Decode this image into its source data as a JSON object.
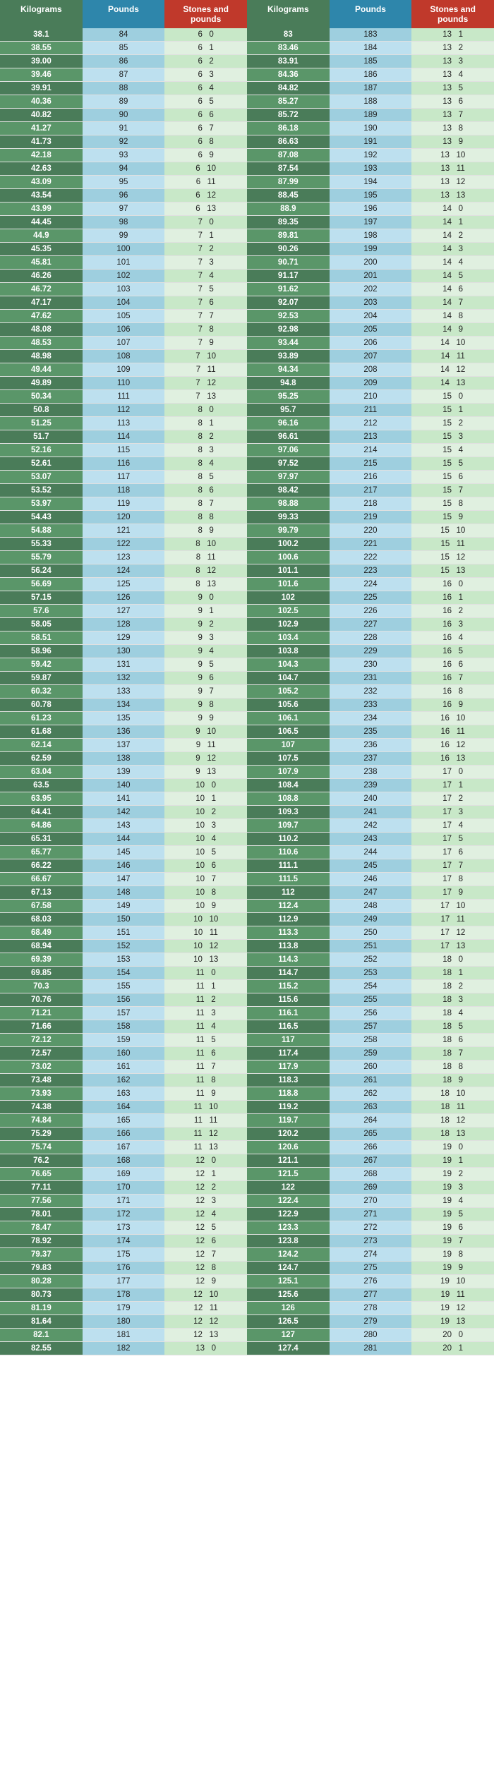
{
  "headers": {
    "kg": "Kilograms",
    "lb": "Pounds",
    "st": "Stones and pounds",
    "kg2": "Kilograms",
    "lb2": "Pounds",
    "st2": "Stones and pounds"
  },
  "rows": [
    [
      38.1,
      84,
      6,
      0,
      83.0,
      183,
      13,
      1
    ],
    [
      38.55,
      85,
      6,
      1,
      83.46,
      184,
      13,
      2
    ],
    [
      39.0,
      86,
      6,
      2,
      83.91,
      185,
      13,
      3
    ],
    [
      39.46,
      87,
      6,
      3,
      84.36,
      186,
      13,
      4
    ],
    [
      39.91,
      88,
      6,
      4,
      84.82,
      187,
      13,
      5
    ],
    [
      40.36,
      89,
      6,
      5,
      85.27,
      188,
      13,
      6
    ],
    [
      40.82,
      90,
      6,
      6,
      85.72,
      189,
      13,
      7
    ],
    [
      41.27,
      91,
      6,
      7,
      86.18,
      190,
      13,
      8
    ],
    [
      41.73,
      92,
      6,
      8,
      86.63,
      191,
      13,
      9
    ],
    [
      42.18,
      93,
      6,
      9,
      87.08,
      192,
      13,
      10
    ],
    [
      42.63,
      94,
      6,
      10,
      87.54,
      193,
      13,
      11
    ],
    [
      43.09,
      95,
      6,
      11,
      87.99,
      194,
      13,
      12
    ],
    [
      43.54,
      96,
      6,
      12,
      88.45,
      195,
      13,
      13
    ],
    [
      43.99,
      97,
      6,
      13,
      88.9,
      196,
      14,
      0
    ],
    [
      44.45,
      98,
      7,
      0,
      89.35,
      197,
      14,
      1
    ],
    [
      44.9,
      99,
      7,
      1,
      89.81,
      198,
      14,
      2
    ],
    [
      45.35,
      100,
      7,
      2,
      90.26,
      199,
      14,
      3
    ],
    [
      45.81,
      101,
      7,
      3,
      90.71,
      200,
      14,
      4
    ],
    [
      46.26,
      102,
      7,
      4,
      91.17,
      201,
      14,
      5
    ],
    [
      46.72,
      103,
      7,
      5,
      91.62,
      202,
      14,
      6
    ],
    [
      47.17,
      104,
      7,
      6,
      92.07,
      203,
      14,
      7
    ],
    [
      47.62,
      105,
      7,
      7,
      92.53,
      204,
      14,
      8
    ],
    [
      48.08,
      106,
      7,
      8,
      92.98,
      205,
      14,
      9
    ],
    [
      48.53,
      107,
      7,
      9,
      93.44,
      206,
      14,
      10
    ],
    [
      48.98,
      108,
      7,
      10,
      93.89,
      207,
      14,
      11
    ],
    [
      49.44,
      109,
      7,
      11,
      94.34,
      208,
      14,
      12
    ],
    [
      49.89,
      110,
      7,
      12,
      94.8,
      209,
      14,
      13
    ],
    [
      50.34,
      111,
      7,
      13,
      95.25,
      210,
      15,
      0
    ],
    [
      50.8,
      112,
      8,
      0,
      95.7,
      211,
      15,
      1
    ],
    [
      51.25,
      113,
      8,
      1,
      96.16,
      212,
      15,
      2
    ],
    [
      51.7,
      114,
      8,
      2,
      96.61,
      213,
      15,
      3
    ],
    [
      52.16,
      115,
      8,
      3,
      97.06,
      214,
      15,
      4
    ],
    [
      52.61,
      116,
      8,
      4,
      97.52,
      215,
      15,
      5
    ],
    [
      53.07,
      117,
      8,
      5,
      97.97,
      216,
      15,
      6
    ],
    [
      53.52,
      118,
      8,
      6,
      98.42,
      217,
      15,
      7
    ],
    [
      53.97,
      119,
      8,
      7,
      98.88,
      218,
      15,
      8
    ],
    [
      54.43,
      120,
      8,
      8,
      99.33,
      219,
      15,
      9
    ],
    [
      54.88,
      121,
      8,
      9,
      99.79,
      220,
      15,
      10
    ],
    [
      55.33,
      122,
      8,
      10,
      100.2,
      221,
      15,
      11
    ],
    [
      55.79,
      123,
      8,
      11,
      100.6,
      222,
      15,
      12
    ],
    [
      56.24,
      124,
      8,
      12,
      101.1,
      223,
      15,
      13
    ],
    [
      56.69,
      125,
      8,
      13,
      101.6,
      224,
      16,
      0
    ],
    [
      57.15,
      126,
      9,
      0,
      102.0,
      225,
      16,
      1
    ],
    [
      57.6,
      127,
      9,
      1,
      102.5,
      226,
      16,
      2
    ],
    [
      58.05,
      128,
      9,
      2,
      102.9,
      227,
      16,
      3
    ],
    [
      58.51,
      129,
      9,
      3,
      103.4,
      228,
      16,
      4
    ],
    [
      58.96,
      130,
      9,
      4,
      103.8,
      229,
      16,
      5
    ],
    [
      59.42,
      131,
      9,
      5,
      104.3,
      230,
      16,
      6
    ],
    [
      59.87,
      132,
      9,
      6,
      104.7,
      231,
      16,
      7
    ],
    [
      60.32,
      133,
      9,
      7,
      105.2,
      232,
      16,
      8
    ],
    [
      60.78,
      134,
      9,
      8,
      105.6,
      233,
      16,
      9
    ],
    [
      61.23,
      135,
      9,
      9,
      106.1,
      234,
      16,
      10
    ],
    [
      61.68,
      136,
      9,
      10,
      106.5,
      235,
      16,
      11
    ],
    [
      62.14,
      137,
      9,
      11,
      107.0,
      236,
      16,
      12
    ],
    [
      62.59,
      138,
      9,
      12,
      107.5,
      237,
      16,
      13
    ],
    [
      63.04,
      139,
      9,
      13,
      107.9,
      238,
      17,
      0
    ],
    [
      63.5,
      140,
      10,
      0,
      108.4,
      239,
      17,
      1
    ],
    [
      63.95,
      141,
      10,
      1,
      108.8,
      240,
      17,
      2
    ],
    [
      64.41,
      142,
      10,
      2,
      109.3,
      241,
      17,
      3
    ],
    [
      64.86,
      143,
      10,
      3,
      109.7,
      242,
      17,
      4
    ],
    [
      65.31,
      144,
      10,
      4,
      110.2,
      243,
      17,
      5
    ],
    [
      65.77,
      145,
      10,
      5,
      110.6,
      244,
      17,
      6
    ],
    [
      66.22,
      146,
      10,
      6,
      111.1,
      245,
      17,
      7
    ],
    [
      66.67,
      147,
      10,
      7,
      111.5,
      246,
      17,
      8
    ],
    [
      67.13,
      148,
      10,
      8,
      112.0,
      247,
      17,
      9
    ],
    [
      67.58,
      149,
      10,
      9,
      112.4,
      248,
      17,
      10
    ],
    [
      68.03,
      150,
      10,
      10,
      112.9,
      249,
      17,
      11
    ],
    [
      68.49,
      151,
      10,
      11,
      113.3,
      250,
      17,
      12
    ],
    [
      68.94,
      152,
      10,
      12,
      113.8,
      251,
      17,
      13
    ],
    [
      69.39,
      153,
      10,
      13,
      114.3,
      252,
      18,
      0
    ],
    [
      69.85,
      154,
      11,
      0,
      114.7,
      253,
      18,
      1
    ],
    [
      70.3,
      155,
      11,
      1,
      115.2,
      254,
      18,
      2
    ],
    [
      70.76,
      156,
      11,
      2,
      115.6,
      255,
      18,
      3
    ],
    [
      71.21,
      157,
      11,
      3,
      116.1,
      256,
      18,
      4
    ],
    [
      71.66,
      158,
      11,
      4,
      116.5,
      257,
      18,
      5
    ],
    [
      72.12,
      159,
      11,
      5,
      117.0,
      258,
      18,
      6
    ],
    [
      72.57,
      160,
      11,
      6,
      117.4,
      259,
      18,
      7
    ],
    [
      73.02,
      161,
      11,
      7,
      117.9,
      260,
      18,
      8
    ],
    [
      73.48,
      162,
      11,
      8,
      118.3,
      261,
      18,
      9
    ],
    [
      73.93,
      163,
      11,
      9,
      118.8,
      262,
      18,
      10
    ],
    [
      74.38,
      164,
      11,
      10,
      119.2,
      263,
      18,
      11
    ],
    [
      74.84,
      165,
      11,
      11,
      119.7,
      264,
      18,
      12
    ],
    [
      75.29,
      166,
      11,
      12,
      120.2,
      265,
      18,
      13
    ],
    [
      75.74,
      167,
      11,
      13,
      120.6,
      266,
      19,
      0
    ],
    [
      76.2,
      168,
      12,
      0,
      121.1,
      267,
      19,
      1
    ],
    [
      76.65,
      169,
      12,
      1,
      121.5,
      268,
      19,
      2
    ],
    [
      77.11,
      170,
      12,
      2,
      122.0,
      269,
      19,
      3
    ],
    [
      77.56,
      171,
      12,
      3,
      122.4,
      270,
      19,
      4
    ],
    [
      78.01,
      172,
      12,
      4,
      122.9,
      271,
      19,
      5
    ],
    [
      78.47,
      173,
      12,
      5,
      123.3,
      272,
      19,
      6
    ],
    [
      78.92,
      174,
      12,
      6,
      123.8,
      273,
      19,
      7
    ],
    [
      79.37,
      175,
      12,
      7,
      124.2,
      274,
      19,
      8
    ],
    [
      79.83,
      176,
      12,
      8,
      124.7,
      275,
      19,
      9
    ],
    [
      80.28,
      177,
      12,
      9,
      125.1,
      276,
      19,
      10
    ],
    [
      80.73,
      178,
      12,
      10,
      125.6,
      277,
      19,
      11
    ],
    [
      81.19,
      179,
      12,
      11,
      126.0,
      278,
      19,
      12
    ],
    [
      81.64,
      180,
      12,
      12,
      126.5,
      279,
      19,
      13
    ],
    [
      82.1,
      181,
      12,
      13,
      127.0,
      280,
      20,
      0
    ],
    [
      82.55,
      182,
      13,
      0,
      127.4,
      281,
      20,
      1
    ]
  ]
}
